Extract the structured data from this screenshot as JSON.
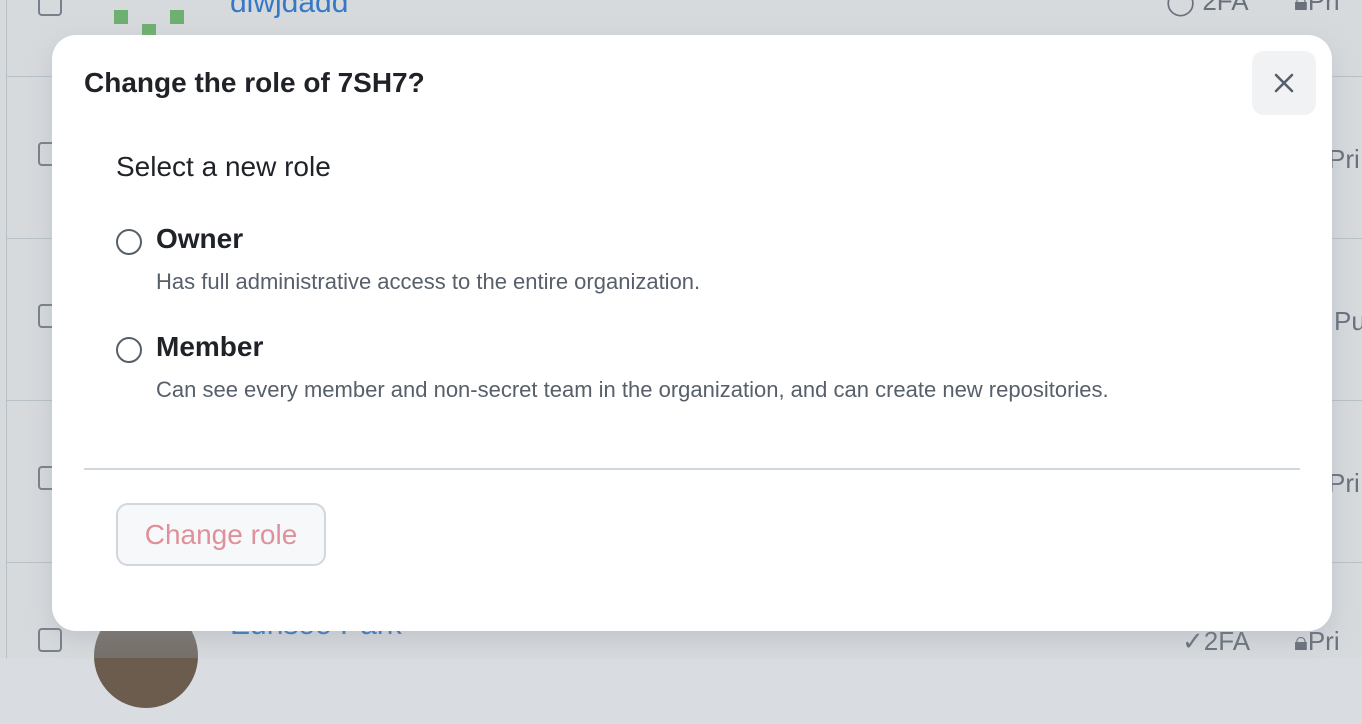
{
  "background": {
    "rows": [
      {
        "name": "diwjdadd",
        "tfa": "2FA",
        "visibility": "Pri"
      },
      {
        "visibility": "Pri"
      },
      {
        "visibility": "Pu"
      },
      {
        "visibility": "Pri"
      },
      {
        "name": "Eunsoo Park",
        "tfa": "2FA",
        "visibility": "Pri"
      }
    ]
  },
  "dialog": {
    "title": "Change the role of 7SH7?",
    "close_icon": "close-icon",
    "legend": "Select a new role",
    "options": [
      {
        "label": "Owner",
        "description": "Has full administrative access to the entire organization.",
        "selected": false
      },
      {
        "label": "Member",
        "description": "Can see every member and non-secret team in the organization, and can create new repositories.",
        "selected": false
      }
    ],
    "submit_label": "Change role",
    "submit_disabled": true
  },
  "colors": {
    "link": "#0969da",
    "text": "#1f2328",
    "muted": "#57606a",
    "disabled_danger": "#e0909a",
    "overlay": "#8c959f"
  }
}
